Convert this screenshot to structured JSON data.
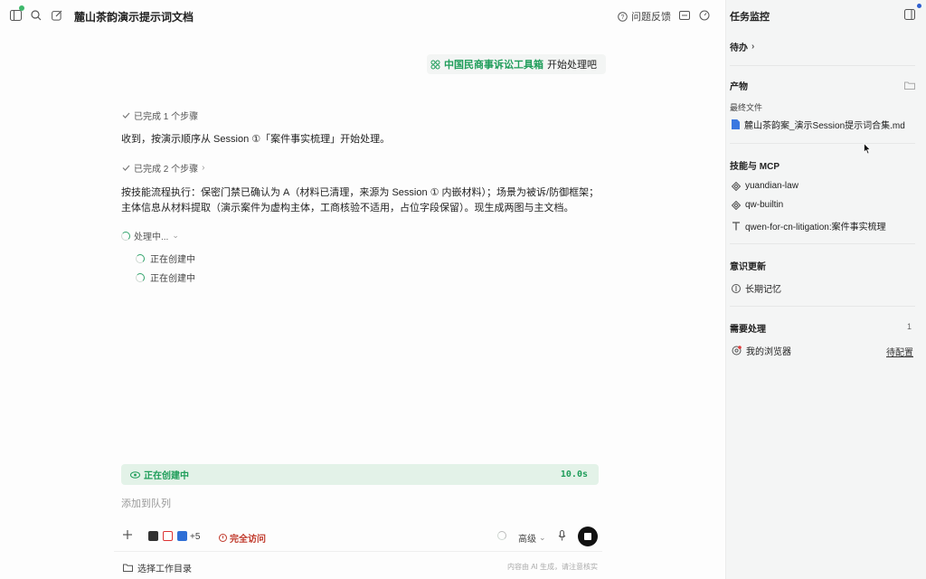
{
  "header": {
    "title": "麓山茶韵演示提示词文档",
    "feedback_label": "问题反馈"
  },
  "chat": {
    "user_message": {
      "tool_name": "中国民商事诉讼工具箱",
      "text": "开始处理吧"
    },
    "step1_label": "已完成 1 个步骤",
    "para1": "收到，按演示顺序从 Session ①「案件事实梳理」开始处理。",
    "step2_label": "已完成 2 个步骤",
    "para2": "按技能流程执行：保密门禁已确认为 A（材料已清理，来源为 Session ① 内嵌材料）；场景为被诉/防御框架；主体信息从材料提取（演示案件为虚构主体，工商核验不适用，占位字段保留）。现生成两图与主文档。",
    "processing_label": "处理中...",
    "subtasks": [
      "正在创建中",
      "正在创建中"
    ]
  },
  "status_bar": {
    "label": "正在创建中",
    "time": "10.0s"
  },
  "composer": {
    "queue_placeholder": "添加到队列",
    "plus_count": "+5",
    "full_access_label": "完全访问",
    "level_label": "高级",
    "workdir_label": "选择工作目录",
    "disclaimer": "内容由 AI 生成，请注意核实"
  },
  "side": {
    "title": "任务监控",
    "todo_label": "待办",
    "artifacts_label": "产物",
    "final_files_label": "最终文件",
    "file_name": "麓山茶韵案_演示Session提示词合集.md",
    "skills_label": "技能与 MCP",
    "skills": [
      "yuandian-law",
      "qw-builtin",
      "qwen-for-cn-litigation:案件事实梳理"
    ],
    "memory_label": "意识更新",
    "memory_item": "长期记忆",
    "needs_label": "需要处理",
    "needs_count": "1",
    "browser_label": "我的浏览器",
    "configure_label": "待配置"
  },
  "colors": {
    "accent_green": "#1f9d5a",
    "status_bg": "#e3f2e8",
    "warning_red": "#c0392b",
    "notify_blue": "#2f5fcf"
  }
}
